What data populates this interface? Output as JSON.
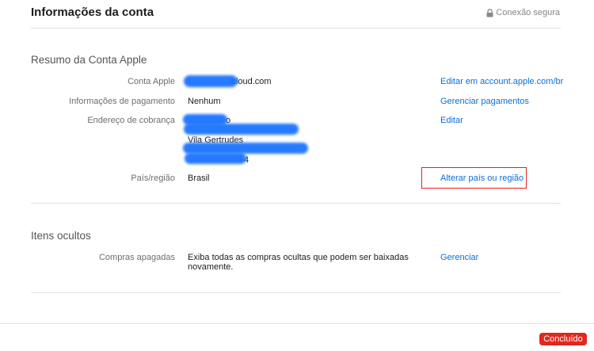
{
  "header": {
    "title": "Informações da conta",
    "secure_label": "Conexão segura"
  },
  "summary": {
    "title": "Resumo da Conta Apple",
    "apple_account_label": "Conta Apple",
    "apple_account_value": "icloud.com",
    "apple_account_link": "Editar em account.apple.com/br",
    "payment_label": "Informações de pagamento",
    "payment_value": "Nenhum",
    "payment_link": "Gerenciar pagamentos",
    "billing_label": "Endereço de cobrança",
    "billing_line_1": "o",
    "billing_line_3": "Vila Gertrudes",
    "billing_line_5": "4",
    "billing_link": "Editar",
    "country_label": "País/região",
    "country_value": "Brasil",
    "country_link": "Alterar país ou região"
  },
  "hidden": {
    "title": "Itens ocultos",
    "purchases_label": "Compras apagadas",
    "purchases_value": "Exiba todas as compras ocultas que podem ser baixadas novamente.",
    "purchases_link": "Gerenciar"
  },
  "footer": {
    "done_label": "Concluído"
  },
  "colors": {
    "link": "#0a6fd8",
    "done_button": "#e0281f",
    "highlight_border": "#e32118",
    "redaction": "#1a73ff"
  },
  "icons": {
    "secure": "lock-icon"
  }
}
